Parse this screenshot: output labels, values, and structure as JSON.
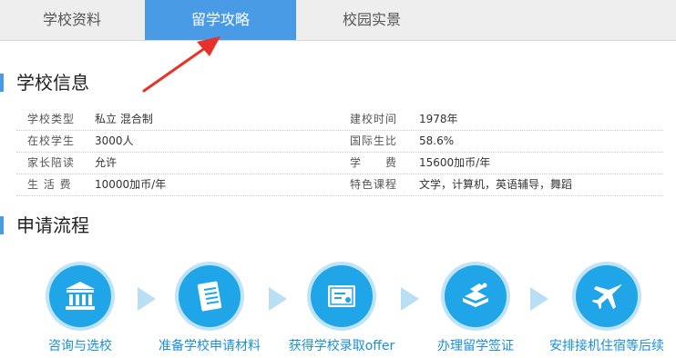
{
  "tabs": [
    {
      "label": "学校资料"
    },
    {
      "label": "留学攻略"
    },
    {
      "label": "校园实景"
    }
  ],
  "school_info": {
    "title": "学校信息",
    "rows": [
      {
        "label1": "学校类型",
        "value1": "私立 混合制",
        "label2": "建校时间",
        "value2": "1978年"
      },
      {
        "label1": "在校学生",
        "value1": "3000人",
        "label2": "国际生比",
        "value2": "58.6%"
      },
      {
        "label1": "家长陪读",
        "value1": "允许",
        "label2": "学　　费",
        "value2": "15600加币/年"
      },
      {
        "label1": "生 活 费",
        "value1": "10000加币/年",
        "label2": "特色课程",
        "value2": "文学，计算机，英语辅导，舞蹈"
      }
    ]
  },
  "process": {
    "title": "申请流程",
    "steps": [
      {
        "label": "咨询与选校",
        "icon": "school-building-icon"
      },
      {
        "label": "准备学校申请材料",
        "icon": "document-icon"
      },
      {
        "label": "获得学校录取offer",
        "icon": "certificate-icon"
      },
      {
        "label": "办理留学签证",
        "icon": "passport-book-icon"
      },
      {
        "label": "安排接机住宿等后续",
        "icon": "airplane-icon"
      }
    ]
  },
  "colors": {
    "accent": "#4a9be6",
    "step_circle": "#1fa5e8",
    "step_text": "#1a8fd8",
    "arrow": "#e8312a"
  }
}
